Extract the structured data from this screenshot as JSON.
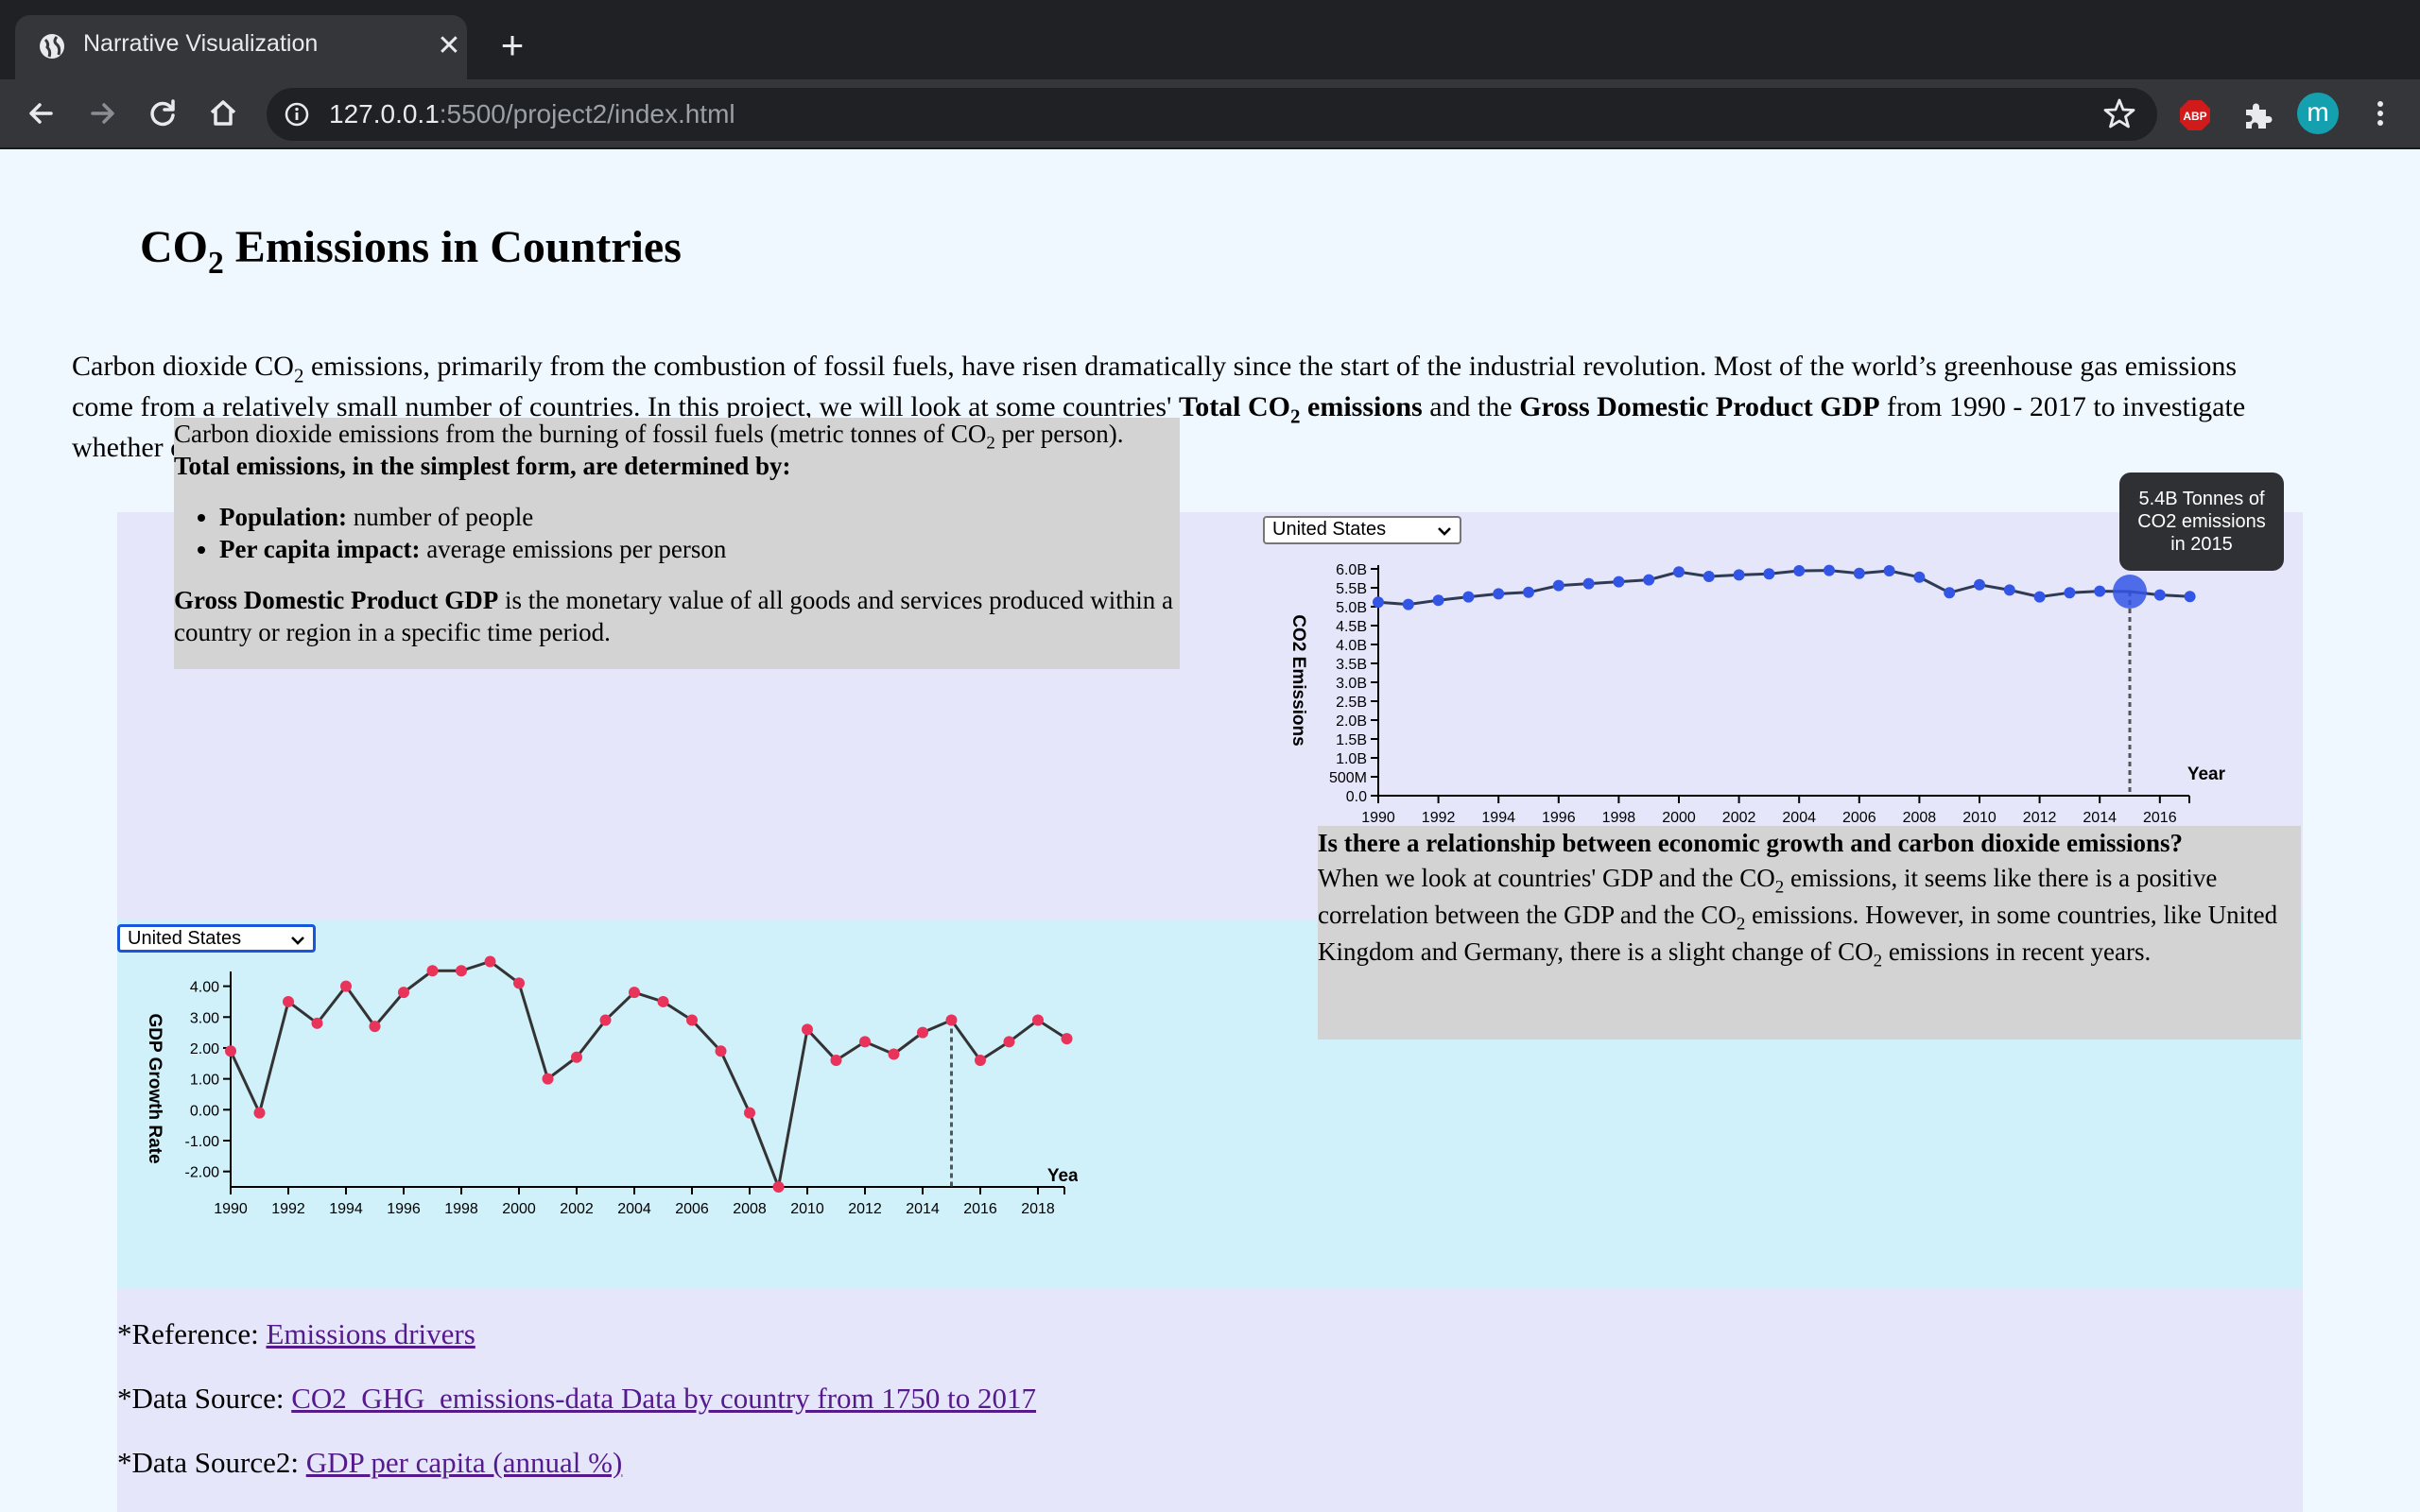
{
  "browser": {
    "tab_title": "Narrative Visualization",
    "url_host": "127.0.0.1",
    "url_path": ":5500/project2/index.html",
    "abp_label": "ABP",
    "avatar_letter": "m"
  },
  "page": {
    "title_pre": "CO",
    "title_sub": "2",
    "title_post": " Emissions in Countries",
    "intro": {
      "p1": "Carbon dioxide CO",
      "p1_sub": "2",
      "p2": " emissions, primarily from the combustion of fossil fuels, have risen dramatically since the start of the industrial revolution. Most of the world’s greenhouse gas emissions come from a relatively small number of countries. In this project, we will look at some countries' ",
      "b1": "Total CO",
      "b1_sub": "2",
      "b1_post": " emissions",
      "p3": " and the ",
      "b2": "Gross Domestic Product GDP",
      "p4": " from 1990 - 2017 to investigate whether or not there is a relationship between economic growth and carbon dioxide emissions."
    },
    "info": {
      "line1_pre": "Carbon dioxide emissions from the burning of fossil fuels (metric tonnes of CO",
      "line1_sub": "2",
      "line1_post": " per person).",
      "line2": "Total emissions, in the simplest form, are determined by:",
      "bullet1_label": "Population:",
      "bullet1_text": " number of people",
      "bullet2_label": "Per capita impact:",
      "bullet2_text": " average emissions per person",
      "gdp_label": "Gross Domestic Product GDP",
      "gdp_text": " is the monetary value of all goods and services produced within a country or region in a specific time period."
    },
    "relationship": {
      "question": "Is there a relationship between economic growth and carbon dioxide emissions?",
      "a1": "When we look at countries' GDP and the CO",
      "a1_sub": "2",
      "a2": " emissions, it seems like there is a positive correlation between the GDP and the CO",
      "a2_sub": "2",
      "a3": " emissions. However, in some countries, like United Kingdom and Germany, there is a slight change of CO",
      "a3_sub": "2",
      "a4": " emissions in recent years."
    },
    "co2_select_value": "United States",
    "gdp_select_value": "United States",
    "tooltip": {
      "line1": "5.4B Tonnes of",
      "line2": "CO2 emissions",
      "line3": "in 2015"
    },
    "references": {
      "ref_label": "*Reference: ",
      "ref_link": "Emissions drivers",
      "src1_label": "*Data Source: ",
      "src1_link": "CO2_GHG_emissions-data Data by country from 1750 to 2017",
      "src2_label": "*Data Source2: ",
      "src2_link": "GDP per capita (annual %)"
    }
  },
  "chart_data": [
    {
      "type": "line",
      "title": "",
      "ylabel": "CO2 Emissions",
      "xlabel": "Year",
      "x": [
        1990,
        1991,
        1992,
        1993,
        1994,
        1995,
        1996,
        1997,
        1998,
        1999,
        2000,
        2001,
        2002,
        2003,
        2004,
        2005,
        2006,
        2007,
        2008,
        2009,
        2010,
        2011,
        2012,
        2013,
        2014,
        2015,
        2016,
        2017
      ],
      "values": [
        5.12,
        5.06,
        5.17,
        5.26,
        5.34,
        5.38,
        5.56,
        5.61,
        5.66,
        5.71,
        5.92,
        5.8,
        5.84,
        5.87,
        5.95,
        5.96,
        5.88,
        5.95,
        5.78,
        5.37,
        5.58,
        5.44,
        5.26,
        5.37,
        5.41,
        5.4,
        5.31,
        5.27
      ],
      "ylim": [
        0,
        6.0
      ],
      "y_ticks": [
        "0.0",
        "500M",
        "1.0B",
        "1.5B",
        "2.0B",
        "2.5B",
        "3.0B",
        "3.5B",
        "4.0B",
        "4.5B",
        "5.0B",
        "5.5B",
        "6.0B"
      ],
      "x_ticks": [
        "1990",
        "1992",
        "1994",
        "1996",
        "1998",
        "2000",
        "2002",
        "2004",
        "2006",
        "2008",
        "2010",
        "2012",
        "2014",
        "2016"
      ],
      "highlight_year": 2015,
      "point_color": "#3355e6",
      "line_color": "#2f3b55"
    },
    {
      "type": "line",
      "title": "",
      "ylabel": "GDP Growth Rate",
      "xlabel": "Year",
      "x": [
        1990,
        1991,
        1992,
        1993,
        1994,
        1995,
        1996,
        1997,
        1998,
        1999,
        2000,
        2001,
        2002,
        2003,
        2004,
        2005,
        2006,
        2007,
        2008,
        2009,
        2010,
        2011,
        2012,
        2013,
        2014,
        2015,
        2016,
        2017,
        2018,
        2019
      ],
      "values": [
        1.9,
        -0.1,
        3.5,
        2.8,
        4.0,
        2.7,
        3.8,
        4.5,
        4.5,
        4.8,
        4.1,
        1.0,
        1.7,
        2.9,
        3.8,
        3.5,
        2.9,
        1.9,
        -0.1,
        -2.5,
        2.6,
        1.6,
        2.2,
        1.8,
        2.5,
        2.9,
        1.6,
        2.2,
        2.9,
        2.3
      ],
      "ylim": [
        -2.5,
        4.6
      ],
      "y_ticks": [
        "-2.00",
        "-1.00",
        "0.00",
        "1.00",
        "2.00",
        "3.00",
        "4.00"
      ],
      "x_ticks": [
        "1990",
        "1992",
        "1994",
        "1996",
        "1998",
        "2000",
        "2002",
        "2004",
        "2006",
        "2008",
        "2010",
        "2012",
        "2014",
        "2016",
        "2018"
      ],
      "highlight_year": 2015,
      "point_color": "#e8335a",
      "line_color": "#333333"
    }
  ]
}
